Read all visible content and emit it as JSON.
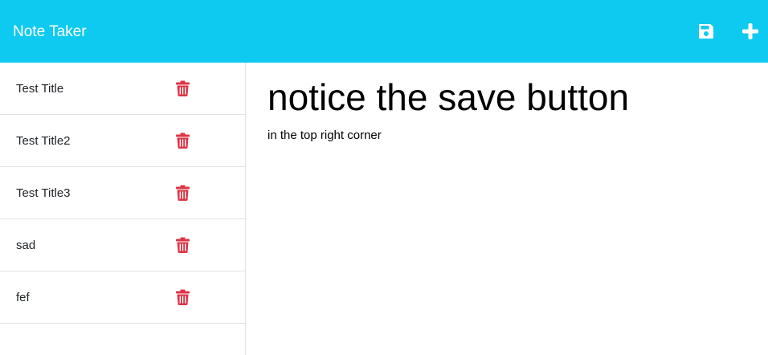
{
  "colors": {
    "navbar": "#0fcaf0",
    "delete": "#dc3545",
    "divider": "#dfe2e6"
  },
  "navbar": {
    "brand": "Note Taker",
    "save_icon": "save-icon",
    "new_icon": "plus-icon"
  },
  "notes": [
    {
      "title": "Test Title",
      "icon": "trash-icon"
    },
    {
      "title": "Test Title2",
      "icon": "trash-icon"
    },
    {
      "title": "Test Title3",
      "icon": "trash-icon"
    },
    {
      "title": "sad",
      "icon": "trash-icon"
    },
    {
      "title": "fef",
      "icon": "trash-icon"
    }
  ],
  "active_note": {
    "title": "notice the save button",
    "text": "in the top right corner"
  }
}
